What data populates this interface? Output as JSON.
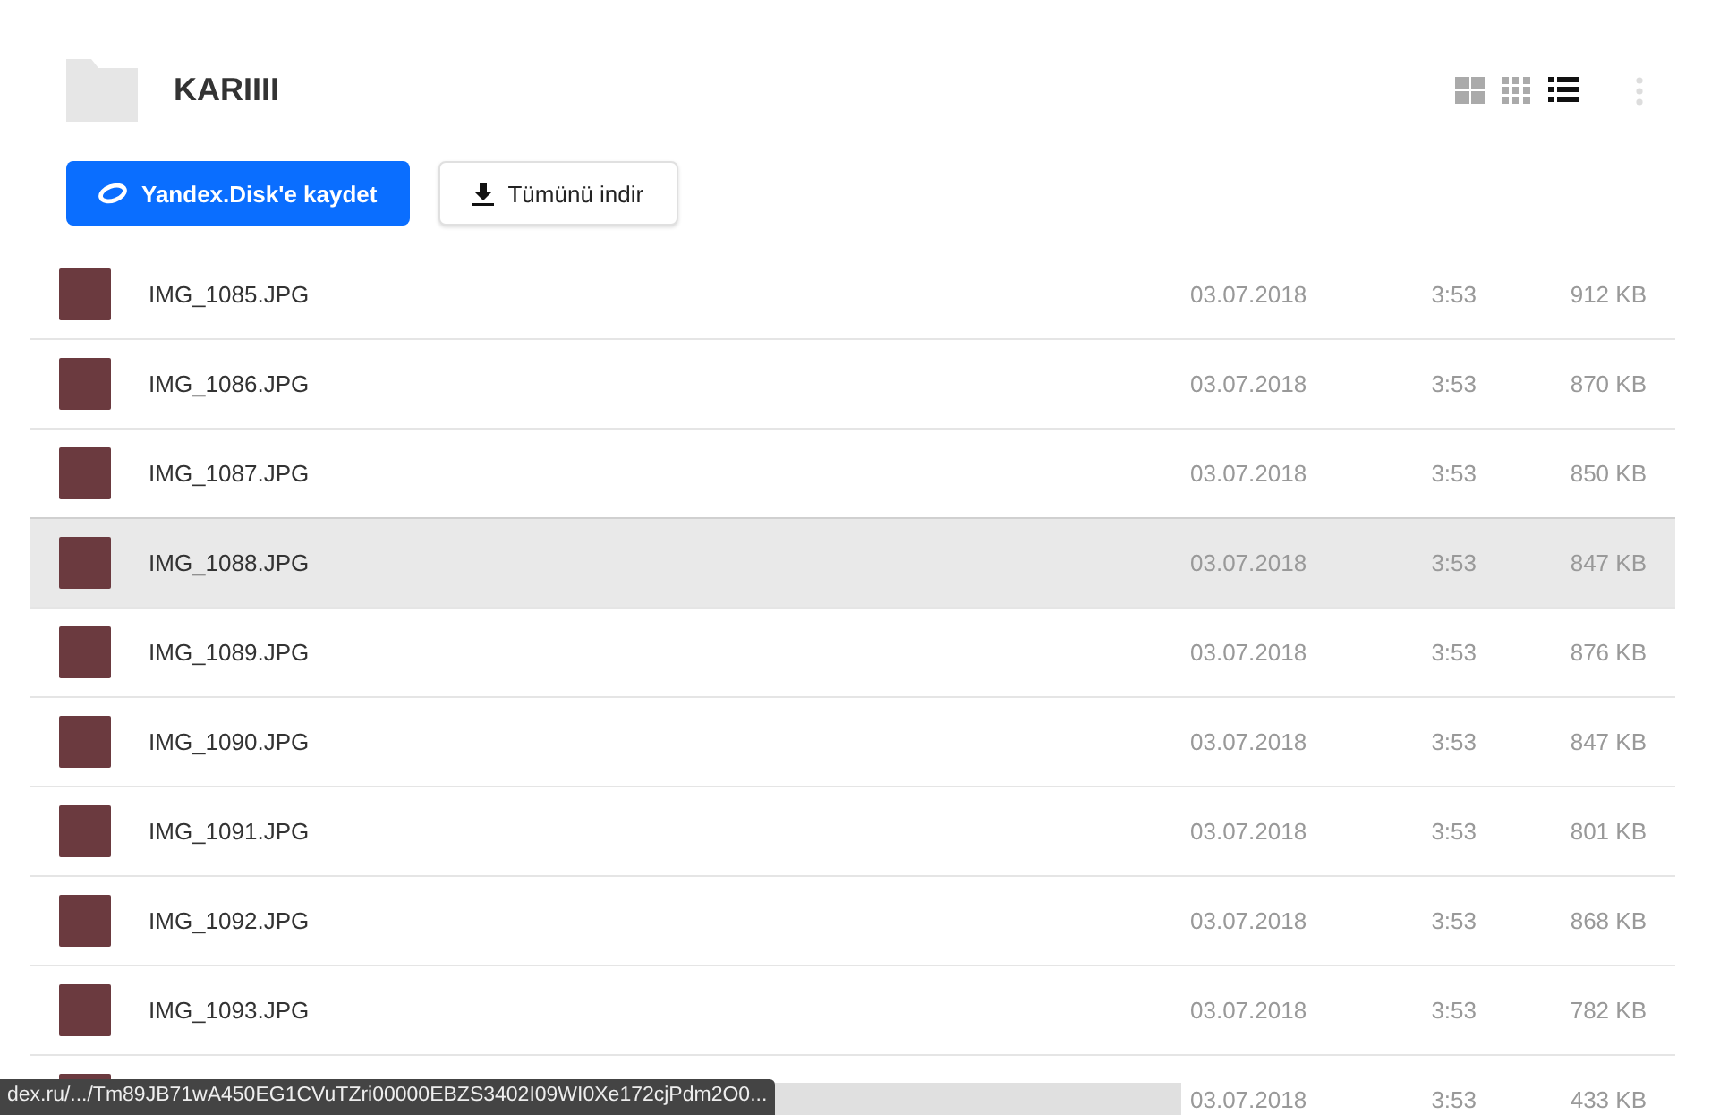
{
  "folder": {
    "title": "KARIIII"
  },
  "view_modes": [
    {
      "kind": "large",
      "selected": false
    },
    {
      "kind": "small",
      "selected": false
    },
    {
      "kind": "list",
      "selected": true
    }
  ],
  "buttons": [
    {
      "kind": "save",
      "label": "Yandex.Disk'e kaydet"
    },
    {
      "kind": "download",
      "label": "Tümünü indir"
    }
  ],
  "files": [
    {
      "name": "IMG_1085.JPG",
      "date": "03.07.2018",
      "time": "3:53",
      "size": "912 KB",
      "hovered": false
    },
    {
      "name": "IMG_1086.JPG",
      "date": "03.07.2018",
      "time": "3:53",
      "size": "870 KB",
      "hovered": false
    },
    {
      "name": "IMG_1087.JPG",
      "date": "03.07.2018",
      "time": "3:53",
      "size": "850 KB",
      "hovered": false
    },
    {
      "name": "IMG_1088.JPG",
      "date": "03.07.2018",
      "time": "3:53",
      "size": "847 KB",
      "hovered": true
    },
    {
      "name": "IMG_1089.JPG",
      "date": "03.07.2018",
      "time": "3:53",
      "size": "876 KB",
      "hovered": false
    },
    {
      "name": "IMG_1090.JPG",
      "date": "03.07.2018",
      "time": "3:53",
      "size": "847 KB",
      "hovered": false
    },
    {
      "name": "IMG_1091.JPG",
      "date": "03.07.2018",
      "time": "3:53",
      "size": "801 KB",
      "hovered": false
    },
    {
      "name": "IMG_1092.JPG",
      "date": "03.07.2018",
      "time": "3:53",
      "size": "868 KB",
      "hovered": false
    },
    {
      "name": "IMG_1093.JPG",
      "date": "03.07.2018",
      "time": "3:53",
      "size": "782 KB",
      "hovered": false
    },
    {
      "date": "03.07.2018",
      "time": "3:53",
      "size": "433 KB",
      "hovered": false
    }
  ],
  "status_bar": {
    "url": "dex.ru/.../Tm89JB71wA450EG1CVuTZri00000EBZS3402I09WI0Xe172cjPdm2O0..."
  }
}
